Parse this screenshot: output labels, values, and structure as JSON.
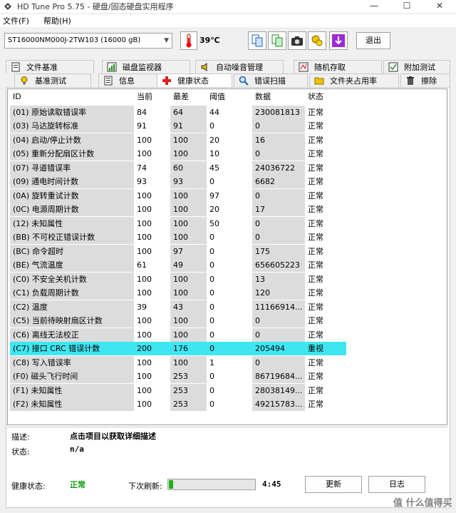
{
  "window": {
    "title": "HD Tune Pro 5.75 - 硬盘/固态硬盘实用程序",
    "minimize": "—",
    "maximize": "☐",
    "close": "✕"
  },
  "menu": {
    "file": "文件(F)",
    "help": "帮助(H)"
  },
  "toolbar": {
    "drive": "ST16000NM000J-2TW103 (16000 gB)",
    "temperature": "39℃",
    "exit_label": "退出"
  },
  "tabs_top": [
    "文件基准",
    "磁盘监视器",
    "自动噪音管理",
    "随机存取",
    "附加测试"
  ],
  "tabs_bottom": [
    "基准测试",
    "信息",
    "健康状态",
    "错误扫描",
    "文件夹占用率",
    "擦除"
  ],
  "active_tab": "健康状态",
  "table": {
    "headers": [
      "ID",
      "当前",
      "最差",
      "阈值",
      "数据",
      "状态"
    ],
    "rows": [
      [
        "(01) 原始读取错误率",
        "84",
        "64",
        "44",
        "230081813",
        "正常"
      ],
      [
        "(03) 马达旋转标准",
        "91",
        "91",
        "0",
        "0",
        "正常"
      ],
      [
        "(04) 启动/停止计数",
        "100",
        "100",
        "20",
        "16",
        "正常"
      ],
      [
        "(05) 重新分配扇区计数",
        "100",
        "100",
        "10",
        "0",
        "正常"
      ],
      [
        "(07) 寻道错误率",
        "74",
        "60",
        "45",
        "24036722",
        "正常"
      ],
      [
        "(09) 通电时间计数",
        "93",
        "93",
        "0",
        "6682",
        "正常"
      ],
      [
        "(0A) 旋转重试计数",
        "100",
        "100",
        "97",
        "0",
        "正常"
      ],
      [
        "(0C) 电源周期计数",
        "100",
        "100",
        "20",
        "17",
        "正常"
      ],
      [
        "(12) 未知属性",
        "100",
        "100",
        "50",
        "0",
        "正常"
      ],
      [
        "(BB) 不可校正错误计数",
        "100",
        "100",
        "0",
        "0",
        "正常"
      ],
      [
        "(BC) 命令超时",
        "100",
        "97",
        "0",
        "175",
        "正常"
      ],
      [
        "(BE) 气流温度",
        "61",
        "49",
        "0",
        "656605223",
        "正常"
      ],
      [
        "(C0) 不安全关机计数",
        "100",
        "100",
        "0",
        "13",
        "正常"
      ],
      [
        "(C1) 负载周期计数",
        "100",
        "100",
        "0",
        "120",
        "正常"
      ],
      [
        "(C2) 温度",
        "39",
        "43",
        "0",
        "11166914...",
        "正常"
      ],
      [
        "(C5) 当前待映射扇区计数",
        "100",
        "100",
        "0",
        "0",
        "正常"
      ],
      [
        "(C6) 离线无法校正",
        "100",
        "100",
        "0",
        "0",
        "正常"
      ],
      [
        "(C7) 接口 CRC 错误计数",
        "200",
        "176",
        "0",
        "205494",
        "重视"
      ],
      [
        "(C8) 写入错误率",
        "100",
        "100",
        "1",
        "0",
        "正常"
      ],
      [
        "(F0) 磁头飞行时间",
        "100",
        "253",
        "0",
        "86719684...",
        "正常"
      ],
      [
        "(F1) 未知属性",
        "100",
        "253",
        "0",
        "28038149...",
        "正常"
      ],
      [
        "(F2) 未知属性",
        "100",
        "253",
        "0",
        "49215783...",
        "正常"
      ]
    ],
    "selected_row": 17
  },
  "details": {
    "description_label": "描述:",
    "description_value": "点击项目以获取详细描述",
    "status_label": "状态:",
    "status_value": "n/a"
  },
  "bottom": {
    "health_label": "健康状态:",
    "health_value": "正常",
    "refresh_label": "下次刷新:",
    "refresh_progress": 0.05,
    "countdown": "4:45",
    "refresh_button": "更新",
    "log_button": "日志"
  },
  "watermark": "值 什么值得买",
  "colors": {
    "selected_row": "#3fe6f2",
    "health_ok": "#10a010",
    "progress": "#1cb01c"
  }
}
